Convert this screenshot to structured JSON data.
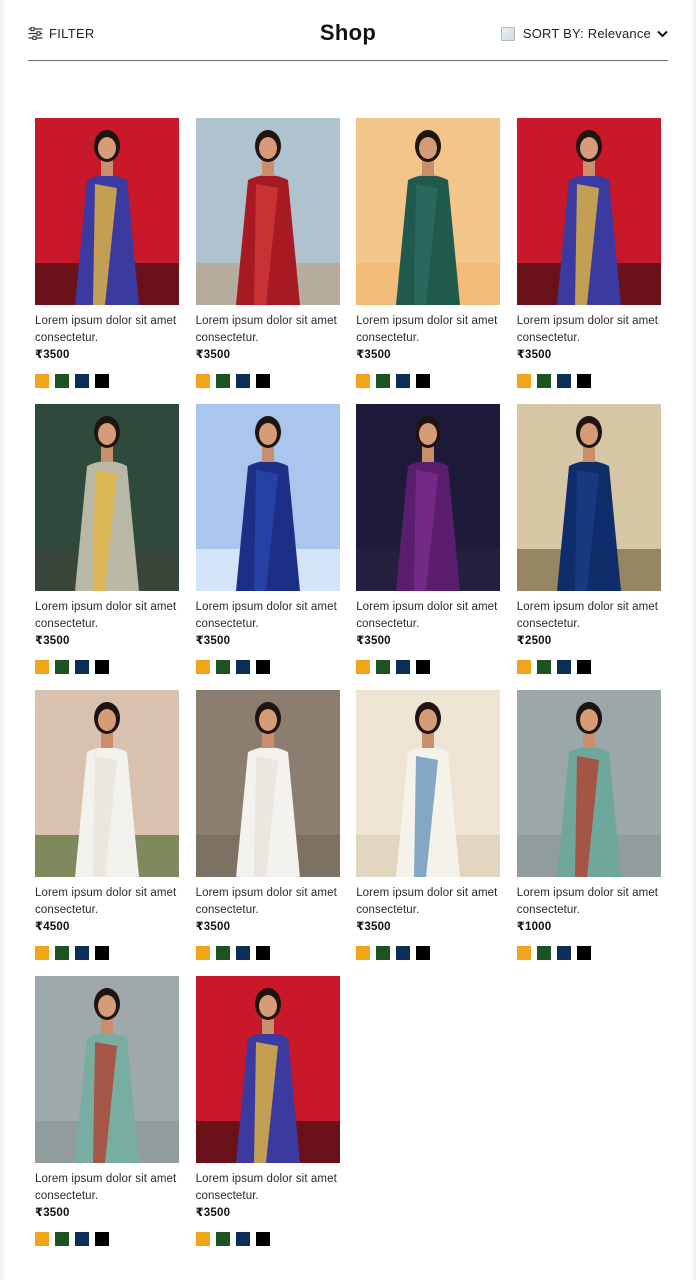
{
  "header": {
    "filter_label": "FILTER",
    "title": "Shop",
    "sort_label": "SORT BY: Relevance"
  },
  "colors": {
    "swatches": [
      "#F2A51A",
      "#1D5323",
      "#0C2D57",
      "#000000"
    ]
  },
  "products": [
    {
      "name": "Lorem ipsum dolor sit amet consectetur.",
      "price": "₹3500",
      "bg": "#C8182A",
      "dress": "#3B3AA0",
      "accent": "#F0C23A",
      "ground": "#5A1018"
    },
    {
      "name": "Lorem ipsum dolor sit amet consectetur.",
      "price": "₹3500",
      "bg": "#AFC3CF",
      "dress": "#A81A22",
      "accent": "#D33B3B",
      "ground": "#B8A995"
    },
    {
      "name": "Lorem ipsum dolor sit amet consectetur.",
      "price": "₹3500",
      "bg": "#F3C58A",
      "dress": "#1F5A4D",
      "accent": "#2C6F62",
      "ground": "#F0B977"
    },
    {
      "name": "Lorem ipsum dolor sit amet consectetur.",
      "price": "₹3500",
      "bg": "#C8182A",
      "dress": "#3B3AA0",
      "accent": "#F0C23A",
      "ground": "#5A1018"
    },
    {
      "name": "Lorem ipsum dolor sit amet consectetur.",
      "price": "₹3500",
      "bg": "#2F4A3A",
      "dress": "#B9B7A6",
      "accent": "#E7B53A",
      "ground": "#3A4438"
    },
    {
      "name": "Lorem ipsum dolor sit amet consectetur.",
      "price": "₹3500",
      "bg": "#A9C6EE",
      "dress": "#1B2F86",
      "accent": "#2B48B0",
      "ground": "#DCE8F8"
    },
    {
      "name": "Lorem ipsum dolor sit amet consectetur.",
      "price": "₹3500",
      "bg": "#1E1B3A",
      "dress": "#5B1E6E",
      "accent": "#7B2E8F",
      "ground": "#26203F"
    },
    {
      "name": "Lorem ipsum dolor sit amet consectetur.",
      "price": "₹2500",
      "bg": "#D6C6A6",
      "dress": "#0F2D6B",
      "accent": "#1E3E86",
      "ground": "#8A7A55"
    },
    {
      "name": "Lorem ipsum dolor sit amet consectetur.",
      "price": "₹4500",
      "bg": "#D9C1B0",
      "dress": "#F2F1EC",
      "accent": "#E7E3D8",
      "ground": "#6D7F4E"
    },
    {
      "name": "Lorem ipsum dolor sit amet consectetur.",
      "price": "₹3500",
      "bg": "#8B7E70",
      "dress": "#F4F2EE",
      "accent": "#E8E3DA",
      "ground": "#7A6E62"
    },
    {
      "name": "Lorem ipsum dolor sit amet consectetur.",
      "price": "₹3500",
      "bg": "#EDE4D3",
      "dress": "#F5F2EA",
      "accent": "#5C8DB8",
      "ground": "#E1D4BD"
    },
    {
      "name": "Lorem ipsum dolor sit amet consectetur.",
      "price": "₹1000",
      "bg": "#9BA7A8",
      "dress": "#6FA89A",
      "accent": "#B63A2A",
      "ground": "#8E9A9B"
    },
    {
      "name": "Lorem ipsum dolor sit amet consectetur.",
      "price": "₹3500",
      "bg": "#9FA9AA",
      "dress": "#78AEA0",
      "accent": "#B63A2A",
      "ground": "#8E9A9B"
    },
    {
      "name": "Lorem ipsum dolor sit amet consectetur.",
      "price": "₹3500",
      "bg": "#C8182A",
      "dress": "#3B3AA0",
      "accent": "#F0C23A",
      "ground": "#5A1018"
    }
  ]
}
